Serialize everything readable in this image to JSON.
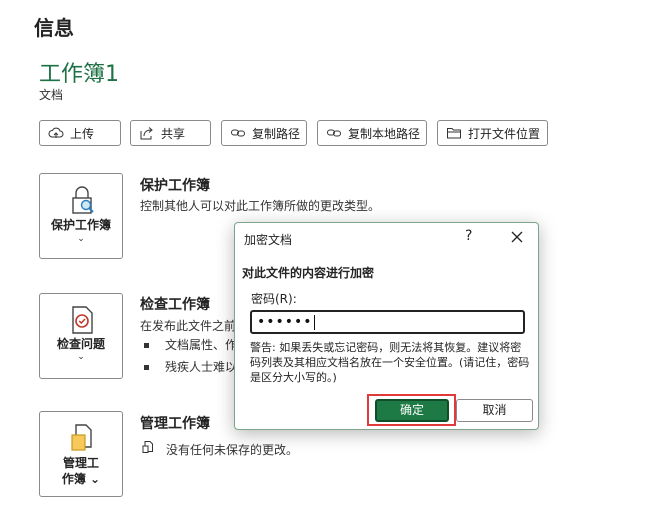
{
  "page": {
    "heading": "信息"
  },
  "workbook": {
    "title": "工作簿1",
    "location": "文档"
  },
  "actions": [
    {
      "label": "上传",
      "icon": "upload-icon"
    },
    {
      "label": "共享",
      "icon": "share-icon"
    },
    {
      "label": "复制路径",
      "icon": "link-icon"
    },
    {
      "label": "复制本地路径",
      "icon": "link-icon"
    },
    {
      "label": "打开文件位置",
      "icon": "folder-icon"
    }
  ],
  "sections": {
    "protect": {
      "button_label": "保护工作簿",
      "chevron": "⌄",
      "title": "保护工作簿",
      "description": "控制其他人可以对此工作簿所做的更改类型。"
    },
    "inspect": {
      "button_label": "检查问题",
      "chevron": "⌄",
      "title": "检查工作簿",
      "description": "在发布此文件之前",
      "bullets": [
        "文档属性、作",
        "残疾人士难以"
      ]
    },
    "manage": {
      "button_label_line1": "管理工",
      "button_label_line2": "作簿 ⌄",
      "title": "管理工作簿",
      "description": "没有任何未保存的更改。"
    }
  },
  "dialog": {
    "title": "加密文档",
    "help": "?",
    "heading": "对此文件的内容进行加密",
    "password_label": "密码(R):",
    "password_value": "••••••",
    "warning": "警告: 如果丢失或忘记密码，则无法将其恢复。建议将密码列表及其相应文档名放在一个安全位置。(请记住，密码是区分大小写的。)",
    "ok_label": "确定",
    "cancel_label": "取消"
  },
  "colors": {
    "accent_green": "#1e7145",
    "ok_button": "#1e7a45",
    "highlight_red": "#e03a3a"
  }
}
